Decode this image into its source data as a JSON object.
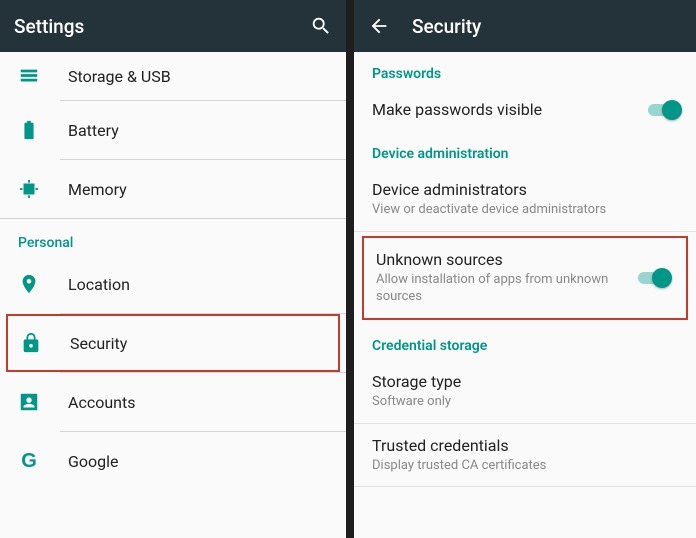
{
  "left": {
    "title": "Settings",
    "section_personal": "Personal",
    "items": {
      "storage": "Storage & USB",
      "battery": "Battery",
      "memory": "Memory",
      "location": "Location",
      "security": "Security",
      "accounts": "Accounts",
      "google": "Google"
    }
  },
  "right": {
    "title": "Security",
    "sections": {
      "passwords": "Passwords",
      "device_admin": "Device administration",
      "credential_storage": "Credential storage"
    },
    "items": {
      "make_passwords_visible": {
        "title": "Make passwords visible"
      },
      "device_administrators": {
        "title": "Device administrators",
        "sub": "View or deactivate device administrators"
      },
      "unknown_sources": {
        "title": "Unknown sources",
        "sub": "Allow installation of apps from unknown sources"
      },
      "storage_type": {
        "title": "Storage type",
        "sub": "Software only"
      },
      "trusted_credentials": {
        "title": "Trusted credentials",
        "sub": "Display trusted CA certificates"
      }
    }
  }
}
